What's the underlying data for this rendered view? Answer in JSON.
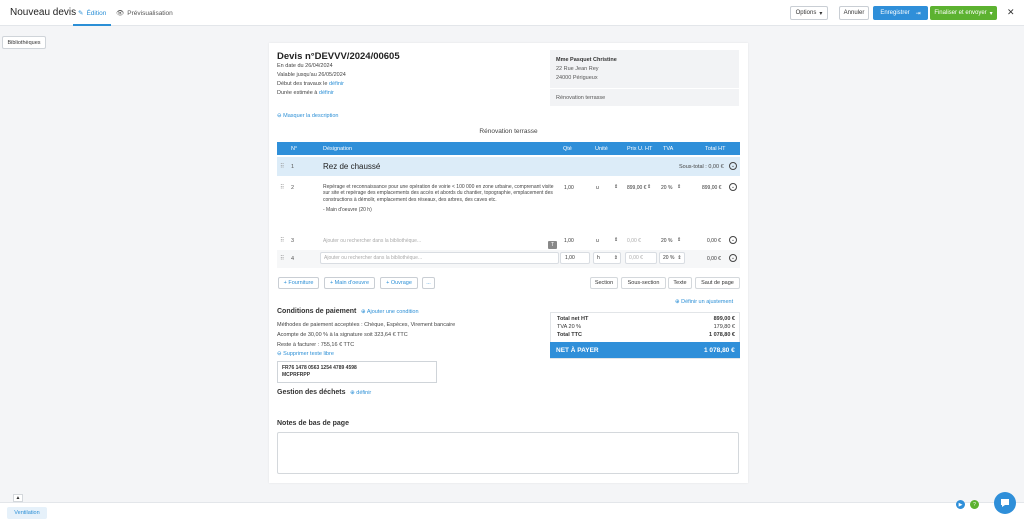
{
  "header": {
    "app_title": "Nouveau devis",
    "tab_edit": "Édition",
    "tab_preview": "Prévisualisation",
    "options": "Options",
    "cancel": "Annuler",
    "save": "Enregistrer",
    "finalize": "Finaliser et envoyer"
  },
  "sidebar": {
    "libraries": "Bibliothèques"
  },
  "quote": {
    "number": "Devis n°DEVVV/2024/00605",
    "date": "En date du 26/04/2024",
    "valid_until": "Valable jusqu'au 26/05/2024",
    "start_label": "Début des travaux le",
    "start_link": "définir",
    "duration_label": "Durée estimée à",
    "duration_link": "définir",
    "hide_description": "Masquer la description",
    "title": "Rénovation terrasse"
  },
  "client": {
    "name": "Mme Pasquet Christine",
    "street": "22 Rue Jean Rey",
    "city": "24000 Périgueux",
    "project": "Rénovation terrasse"
  },
  "table": {
    "headers": {
      "num": "N°",
      "designation": "Désignation",
      "qty": "Qté",
      "unit": "Unité",
      "unit_price": "Prix U. HT",
      "vat": "TVA",
      "total": "Total HT"
    },
    "section": {
      "num": "1",
      "title": "Rez de chaussé",
      "subtotal": "Sous-total : 0,00 €"
    },
    "row2": {
      "num": "2",
      "desc1": "Repérage et reconnaissance pour une opération de voirie < 100 000     en zone urbaine, comprenant visite sur site et repérage des emplacements des accès et abords du chantier, topographie, emplacement des constructions à démolir, emplacement des réseaux, des arbres, des caves etc.",
      "desc2": "- Main d'oeuvre (20 h)",
      "qty": "1,00",
      "unit": "u",
      "price": "899,00 €",
      "vat": "20 %",
      "total": "899,00 €"
    },
    "row3": {
      "num": "3",
      "placeholder": "Ajouter ou rechercher dans la bibliothèque...",
      "qty": "1,00",
      "unit": "u",
      "price": "0,00 €",
      "vat": "20 %",
      "total": "0,00 €"
    },
    "row4": {
      "num": "4",
      "placeholder": "Ajouter ou rechercher dans la bibliothèque...",
      "qty": "1,00",
      "unit": "h",
      "price": "0,00 €",
      "vat": "20 %",
      "total": "0,00 €"
    },
    "tooltip_badge": "T",
    "add_buttons": [
      "+ Fourniture",
      "+ Main d'oeuvre",
      "+ Ouvrage",
      "..."
    ],
    "section_buttons": [
      "Section",
      "Sous-section",
      "Texte",
      "Saut de page"
    ]
  },
  "payment": {
    "title": "Conditions de paiement",
    "add_condition": "Ajouter une condition",
    "methods": "Méthodes de paiement acceptées : Chèque, Espèces, Virement bancaire",
    "deposit": "Acompte de 30,00 % à la signature soit 323,64 € TTC",
    "remaining": "Reste à facturer : 755,16 € TTC",
    "delete_text": "Supprimer texte libre",
    "iban": "FR76 1478 0563 1254 4789 4598",
    "bic": "MCPRFRPP"
  },
  "waste": {
    "title": "Gestion des déchets",
    "link": "définir"
  },
  "totals": {
    "adjust": "Définir un ajustement",
    "net_ht_label": "Total net HT",
    "net_ht": "899,00 €",
    "vat_label": "TVA 20 %",
    "vat": "179,80 €",
    "ttc_label": "Total TTC",
    "ttc": "1 078,80 €",
    "to_pay_label": "NET À PAYER",
    "to_pay": "1 078,80 €"
  },
  "notes": {
    "title": "Notes de bas de page"
  },
  "footer": {
    "ventilation": "Ventilation"
  },
  "colors": {
    "accent": "#2f8fd9",
    "green": "#5cb230",
    "section_bg": "#dcecf8"
  }
}
